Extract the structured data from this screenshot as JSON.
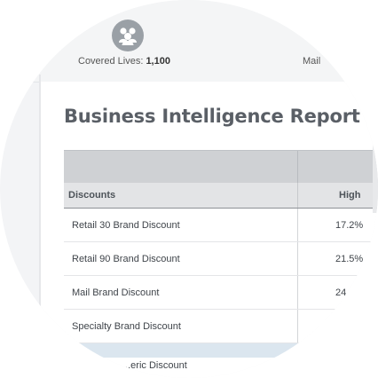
{
  "summary": {
    "covered_label": "Covered Lives:",
    "covered_value": "1,100",
    "mail_label_partial": "Mail",
    "icon": "people-group-icon"
  },
  "report": {
    "title": "Business Intelligence Report",
    "columns": [
      "Discounts",
      "High"
    ],
    "rows": [
      {
        "name": "Retail 30 Brand Discount",
        "high": "17.2%"
      },
      {
        "name": "Retail 90 Brand Discount",
        "high": "21.5%"
      },
      {
        "name": "Mail Brand Discount",
        "high": "24"
      },
      {
        "name": "Specialty Brand Discount",
        "high": ""
      }
    ],
    "partial_row": "...eric Discount"
  },
  "colors": {
    "title": "#5a5f66",
    "header_dark": "#cfd1d4",
    "header_light": "#e3e4e6",
    "highlight_band": "#dbe6ef"
  }
}
